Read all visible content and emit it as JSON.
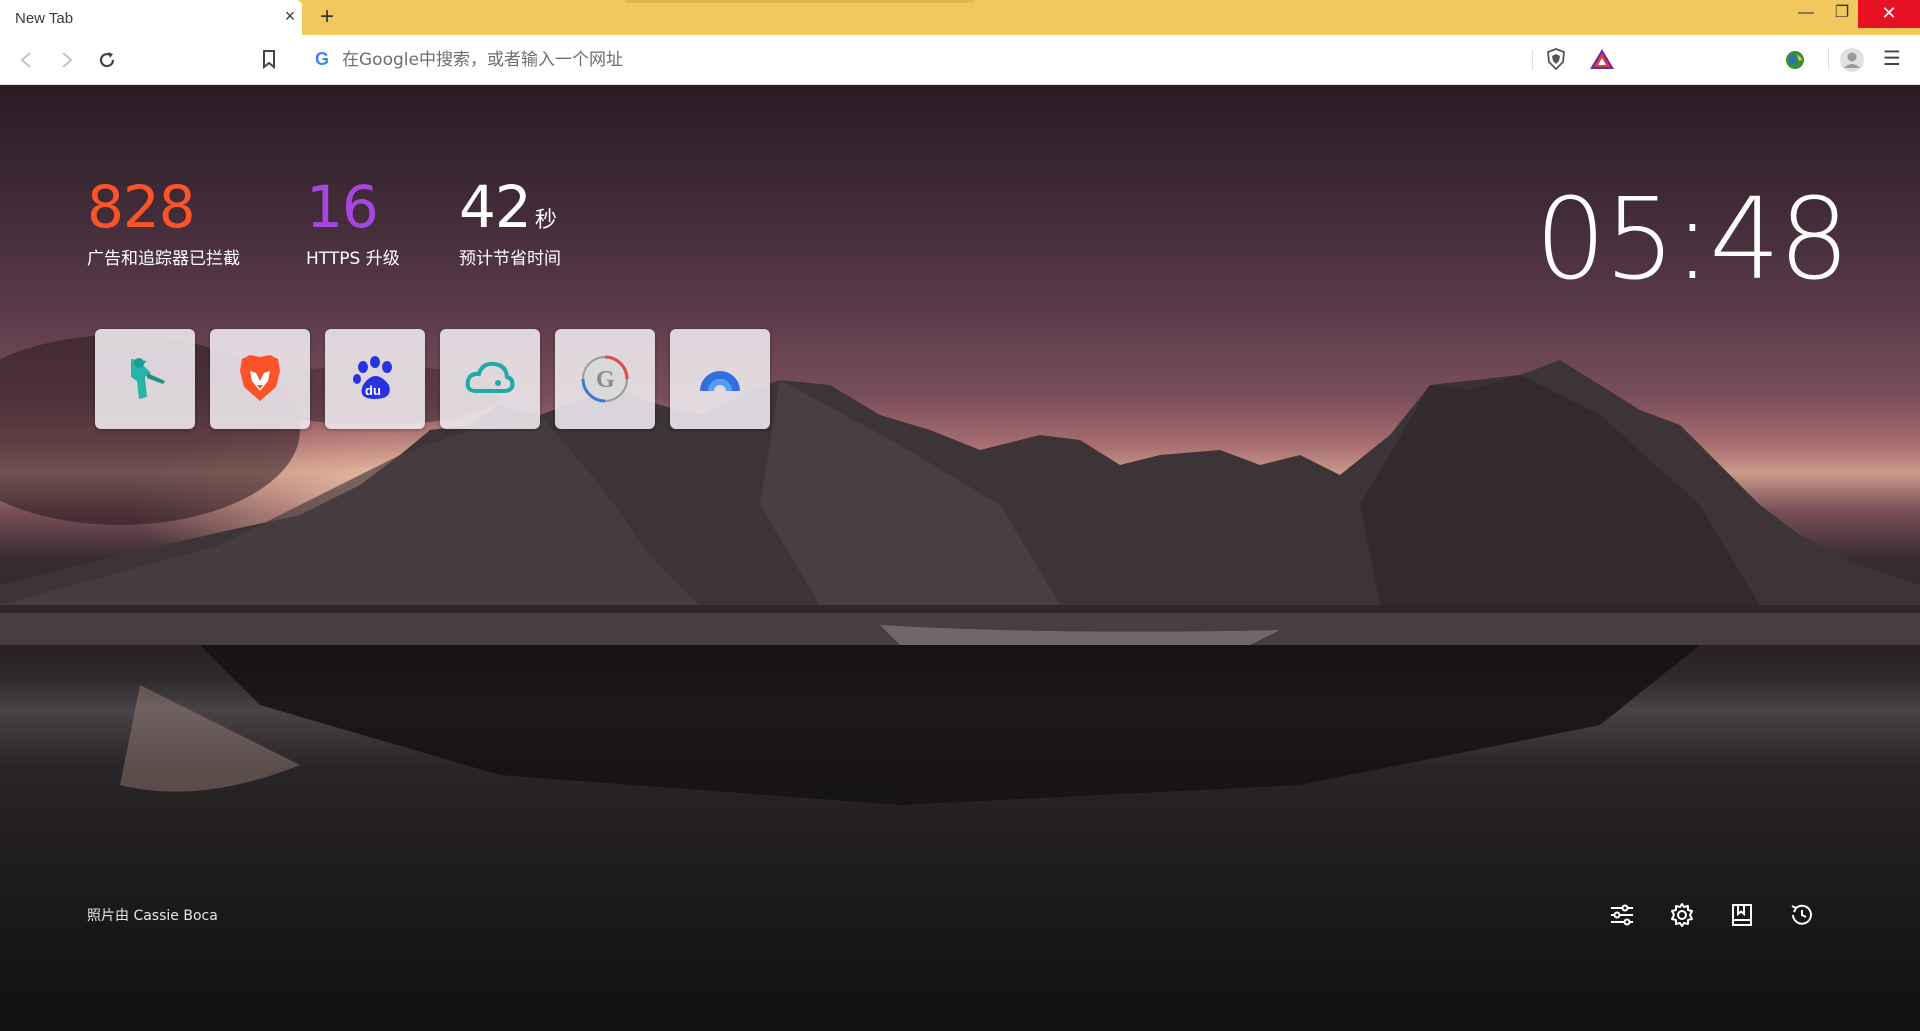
{
  "window": {
    "tab_title": "New Tab",
    "tab_close": "×",
    "new_tab": "+",
    "minimize": "—",
    "maximize": "❐",
    "close": "✕"
  },
  "toolbar": {
    "search_placeholder": "在Google中搜索，或者输入一个网址",
    "search_engine_icon": "G",
    "menu_glyph": "☰"
  },
  "stats": {
    "ads_blocked": {
      "value": "828",
      "label": "广告和追踪器已拦截",
      "color": "#fb542b"
    },
    "https_upgrades": {
      "value": "16",
      "label": "HTTPS 升级",
      "color": "#a646e0"
    },
    "time_saved": {
      "value": "42",
      "unit": "秒",
      "label": "预计节省时间"
    }
  },
  "clock": "05:48",
  "top_sites": [
    {
      "name": "tile-1-icon",
      "description": "teal figure icon"
    },
    {
      "name": "brave-lion-icon",
      "description": "Brave"
    },
    {
      "name": "baidu-paw-icon",
      "description": "Baidu"
    },
    {
      "name": "cloud-icon",
      "description": "cloud"
    },
    {
      "name": "globe-icon",
      "description": "G globe"
    },
    {
      "name": "arc-icon",
      "description": "blue arc"
    }
  ],
  "photo_credit": "照片由 Cassie Boca",
  "footer_icons": [
    "customize-icon",
    "settings-gear-icon",
    "bookmarks-icon",
    "history-clock-icon"
  ]
}
